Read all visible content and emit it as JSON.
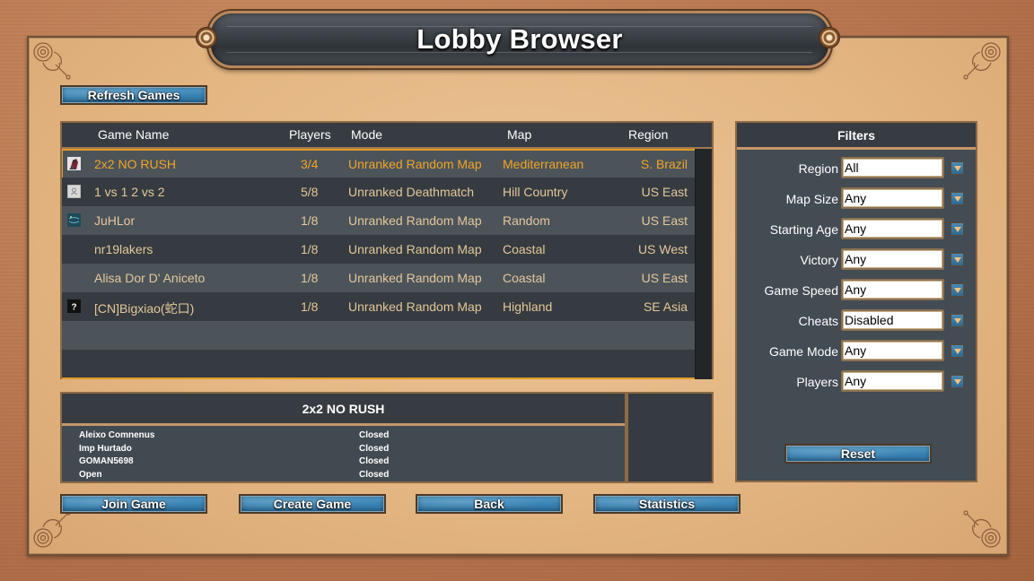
{
  "title": "Lobby Browser",
  "toolbar": {
    "refresh_label": "Refresh Games"
  },
  "game_list": {
    "columns": {
      "name": "Game Name",
      "players": "Players",
      "mode": "Mode",
      "map": "Map",
      "region": "Region"
    },
    "rows": [
      {
        "icon": "warrior-avatar-icon",
        "name": "2x2 NO RUSH",
        "players": "3/4",
        "mode": "Unranked Random Map",
        "map": "Mediterranean",
        "region": "S. Brazil",
        "selected": true
      },
      {
        "icon": "default-avatar-icon",
        "name": "1 vs 1 2 vs 2",
        "players": "5/8",
        "mode": "Unranked Deathmatch",
        "map": "Hill Country",
        "region": "US East"
      },
      {
        "icon": "map-avatar-icon",
        "name": "JuHLor",
        "players": "1/8",
        "mode": "Unranked Random Map",
        "map": "Random",
        "region": "US East"
      },
      {
        "icon": "",
        "name": "nr19lakers",
        "players": "1/8",
        "mode": "Unranked Random Map",
        "map": "Coastal",
        "region": "US West"
      },
      {
        "icon": "",
        "name": "Alisa Dor D' Aniceto",
        "players": "1/8",
        "mode": "Unranked Random Map",
        "map": "Coastal",
        "region": "US East"
      },
      {
        "icon": "unknown-avatar-icon",
        "name": "[CN]Bigxiao(蛇口)",
        "players": "1/8",
        "mode": "Unranked Random Map",
        "map": "Highland",
        "region": "SE Asia"
      }
    ]
  },
  "details": {
    "game_name": "2x2 NO RUSH",
    "players": [
      {
        "name": "Aleixo Comnenus",
        "status": "Closed"
      },
      {
        "name": "Imp Hurtado",
        "status": "Closed"
      },
      {
        "name": "GOMAN5698",
        "status": "Closed"
      },
      {
        "name": "Open",
        "status": "Closed"
      }
    ]
  },
  "filters": {
    "title": "Filters",
    "items": [
      {
        "label": "Region",
        "value": "All"
      },
      {
        "label": "Map Size",
        "value": "Any"
      },
      {
        "label": "Starting Age",
        "value": "Any"
      },
      {
        "label": "Victory",
        "value": "Any"
      },
      {
        "label": "Game Speed",
        "value": "Any"
      },
      {
        "label": "Cheats",
        "value": "Disabled"
      },
      {
        "label": "Game Mode",
        "value": "Any"
      },
      {
        "label": "Players",
        "value": "Any"
      }
    ],
    "reset_label": "Reset"
  },
  "actions": {
    "join_label": "Join Game",
    "create_label": "Create Game",
    "back_label": "Back",
    "statistics_label": "Statistics"
  },
  "colors": {
    "selected_text": "#f0a426",
    "row_text": "#e4c79a",
    "button_blue": "#3b86b6"
  }
}
